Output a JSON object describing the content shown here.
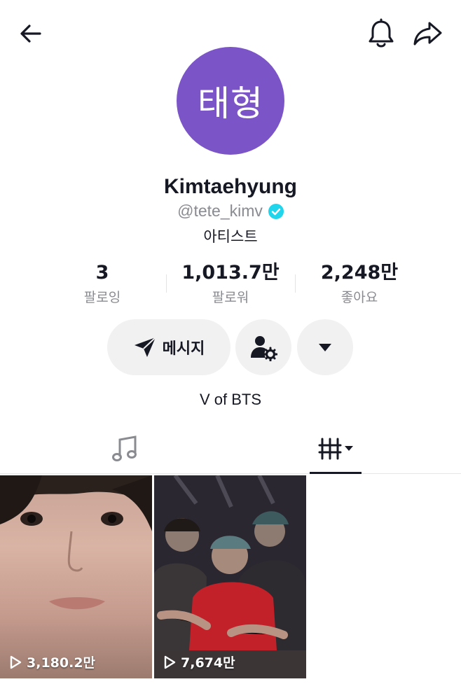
{
  "theme": {
    "avatar_bg": "#7b55c7",
    "verified": "#20d5ec",
    "accent_text": "#161823",
    "muted_text": "#8a8b91"
  },
  "header": {
    "back_icon": "arrow-left-icon",
    "bell_icon": "bell-icon",
    "share_icon": "share-arrow-icon"
  },
  "profile": {
    "avatar_text": "태형",
    "display_name": "Kimtaehyung",
    "username": "@tete_kimv",
    "verified": true,
    "category": "아티스트",
    "bio": "V of BTS"
  },
  "stats": {
    "following": {
      "value": "3",
      "label": "팔로잉"
    },
    "followers": {
      "value": "1,013.7만",
      "label": "팔로워"
    },
    "likes": {
      "value": "2,248만",
      "label": "좋아요"
    }
  },
  "actions": {
    "message_label": "메시지",
    "message_icon": "paper-plane-icon",
    "user_settings_icon": "user-gear-icon",
    "more_icon": "caret-down-icon"
  },
  "tabs": [
    {
      "name": "music",
      "icon": "music-note-icon",
      "selected": false
    },
    {
      "name": "videos",
      "icon": "grid-bars-icon",
      "selected": true
    }
  ],
  "videos": [
    {
      "views": "3,180.2만"
    },
    {
      "views": "7,674만"
    }
  ]
}
